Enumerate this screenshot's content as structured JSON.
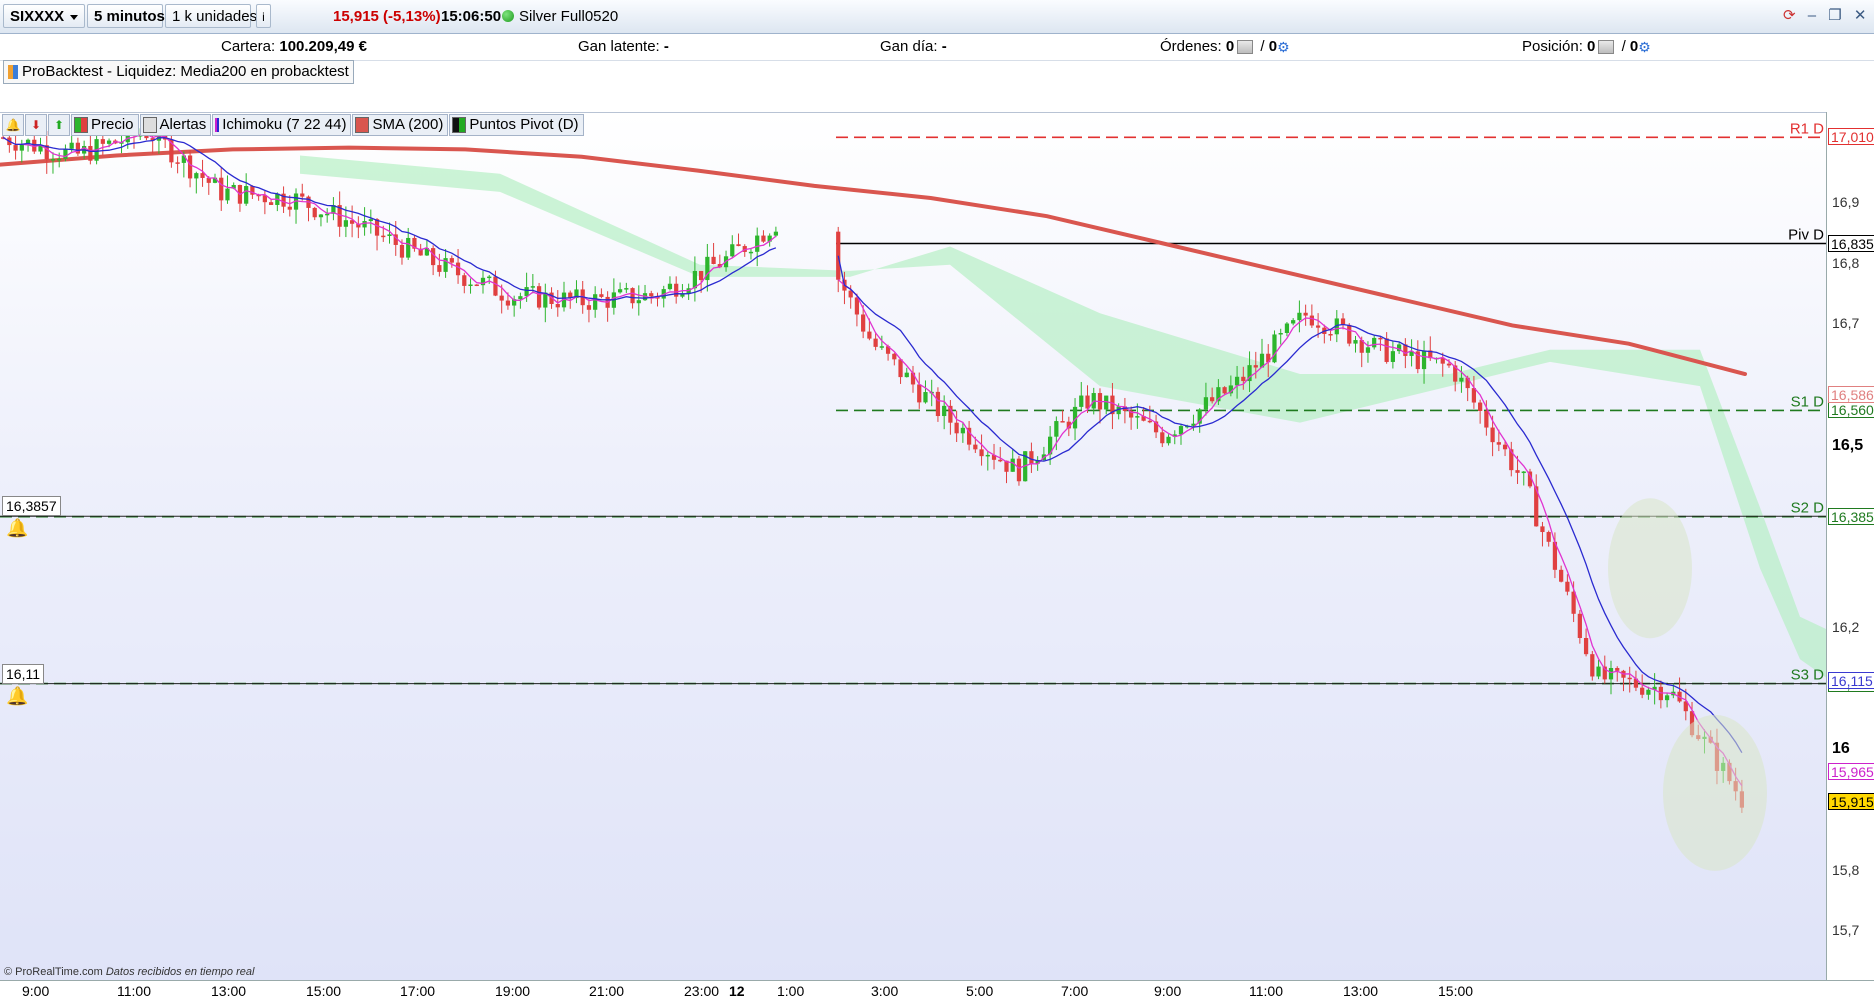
{
  "toolbar": {
    "symbol": "SIXXXX",
    "timeframe": "5 minutos",
    "units": "1 k unidades",
    "info_icon": "info-icon",
    "price_change": "15,915 (-5,13%)",
    "time": "15:06:50",
    "account_name": "Silver Full0520",
    "status_color": "#1d9a1d"
  },
  "account_bar": {
    "cartera_label": "Cartera:",
    "cartera_value": "100.209,49 €",
    "gan_latente_label": "Gan latente:",
    "gan_latente_value": "-",
    "gan_dia_label": "Gan día:",
    "gan_dia_value": "-",
    "ordenes_label": "Órdenes:",
    "ordenes_value_1": "0",
    "ordenes_sep": "/",
    "ordenes_value_2": "0",
    "posicion_label": "Posición:",
    "posicion_value_1": "0",
    "posicion_sep": "/",
    "posicion_value_2": "0"
  },
  "strategy": {
    "label": "ProBacktest - Liquidez: Media200 en probacktest"
  },
  "indicators": [
    {
      "label": "Precio",
      "color": "#2db52d"
    },
    {
      "label": "Alertas",
      "color": "#dddddd"
    },
    {
      "label": "Ichimoku (7 22 44)",
      "color": "#cc22cc"
    },
    {
      "label": "SMA (200)",
      "color": "#d9564f"
    },
    {
      "label": "Puntos Pivot (D)",
      "color": "#1a1a1a"
    }
  ],
  "pivots": [
    {
      "label": "R1 D",
      "value": "17,010",
      "price": 17.01,
      "color": "#e23030",
      "dash": true
    },
    {
      "label": "Piv D",
      "value": "16,835",
      "price": 16.835,
      "color": "#000000",
      "dash": false
    },
    {
      "label": "S1 D",
      "value": "16,560",
      "price": 16.56,
      "color": "#1f7a1f",
      "dash": true
    },
    {
      "label": "S2 D",
      "value": "16,385",
      "price": 16.385,
      "color": "#1f7a1f",
      "dash": true
    },
    {
      "label": "S3 D",
      "value": "16,110",
      "price": 16.11,
      "color": "#1f7a1f",
      "dash": true
    }
  ],
  "alerts": [
    {
      "label": "16,3857",
      "price": 16.3857
    },
    {
      "label": "16,11",
      "price": 16.11
    }
  ],
  "y_axis": {
    "ticks": [
      {
        "label": "16,9",
        "value": 16.9,
        "bold": false
      },
      {
        "label": "16,8",
        "value": 16.8,
        "bold": false
      },
      {
        "label": "16,7",
        "value": 16.7,
        "bold": false
      },
      {
        "label": "16,5",
        "value": 16.5,
        "bold": true
      },
      {
        "label": "16,2",
        "value": 16.2,
        "bold": false
      },
      {
        "label": "16",
        "value": 16.0,
        "bold": true
      },
      {
        "label": "15,8",
        "value": 15.8,
        "bold": false
      },
      {
        "label": "15,7",
        "value": 15.7,
        "bold": false
      }
    ],
    "boxes": [
      {
        "label": "16,586",
        "price": 16.586,
        "color": "#e08080"
      },
      {
        "label": "16,115",
        "price": 16.115,
        "color": "#3a3ad0"
      },
      {
        "label": "15,965",
        "price": 15.965,
        "color": "#cc22cc"
      },
      {
        "label": "15,915",
        "price": 15.915,
        "color": "#000000",
        "bg": "#ffd800"
      }
    ]
  },
  "x_axis": {
    "ticks": [
      "9:00",
      "11:00",
      "13:00",
      "15:00",
      "17:00",
      "19:00",
      "21:00",
      "23:00",
      "12",
      "1:00",
      "3:00",
      "5:00",
      "7:00",
      "9:00",
      "11:00",
      "13:00",
      "15:00"
    ],
    "bold_tick": "12"
  },
  "chart_data": {
    "type": "line",
    "ylim": [
      15.62,
      17.05
    ],
    "sma200": [
      16.965,
      16.98,
      16.99,
      16.993,
      16.99,
      16.978,
      16.955,
      16.93,
      16.91,
      16.88,
      16.835,
      16.79,
      16.745,
      16.7,
      16.67,
      16.62
    ],
    "price_close": [
      17.01,
      16.98,
      17.02,
      16.92,
      16.91,
      16.86,
      16.8,
      16.75,
      16.74,
      16.75,
      16.81,
      16.9,
      16.67,
      16.55,
      16.46,
      16.58,
      16.52,
      16.6,
      16.72,
      16.66,
      16.63,
      16.44,
      16.12,
      16.1,
      15.92
    ]
  },
  "footer": {
    "brand": "© ProRealTime.com",
    "note": "Datos recibidos en tiempo real"
  }
}
